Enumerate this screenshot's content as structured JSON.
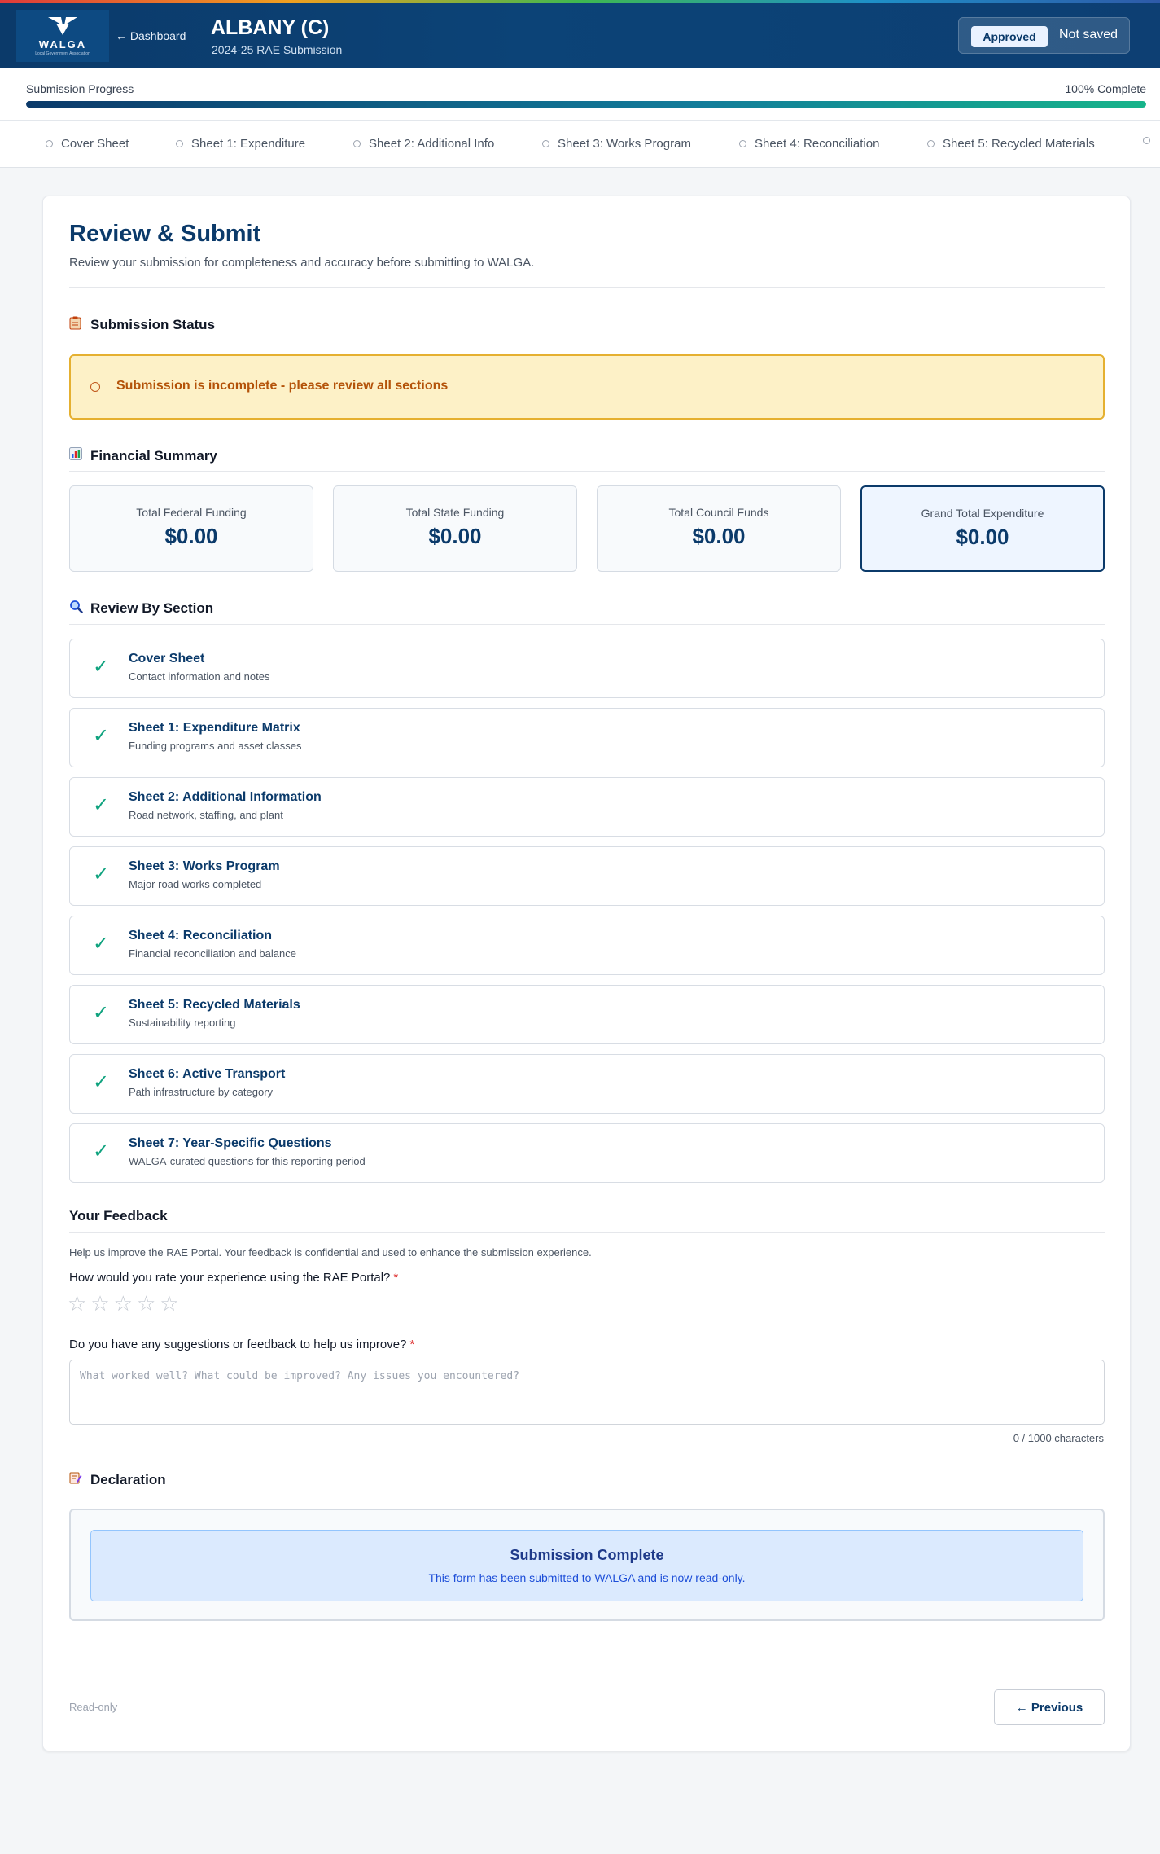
{
  "header": {
    "logo_text": "WALGA",
    "logo_sub": "Local Government Association",
    "back_label": "← Dashboard",
    "council_name": "ALBANY (C)",
    "subtitle": "2024-25 RAE Submission",
    "status_badge": "Approved",
    "save_status": "Not saved"
  },
  "progress": {
    "label": "Submission Progress",
    "percent_label": "100% Complete",
    "percent": 100
  },
  "tabs": [
    {
      "label": "Cover Sheet"
    },
    {
      "label": "Sheet 1: Expenditure"
    },
    {
      "label": "Sheet 2: Additional Info"
    },
    {
      "label": "Sheet 3: Works Program"
    },
    {
      "label": "Sheet 4: Reconciliation"
    },
    {
      "label": "Sheet 5: Recycled Materials"
    }
  ],
  "page": {
    "title": "Review & Submit",
    "description": "Review your submission for completeness and accuracy before submitting to WALGA."
  },
  "status_section": {
    "title": "Submission Status",
    "icon": "clipboard-icon",
    "alert_text": "Submission is incomplete - please review all sections"
  },
  "financial": {
    "title": "Financial Summary",
    "icon": "bar-chart-icon",
    "cards": [
      {
        "label": "Total Federal Funding",
        "value": "$0.00"
      },
      {
        "label": "Total State Funding",
        "value": "$0.00"
      },
      {
        "label": "Total Council Funds",
        "value": "$0.00"
      },
      {
        "label": "Grand Total Expenditure",
        "value": "$0.00"
      }
    ]
  },
  "review": {
    "title": "Review By Section",
    "icon": "magnifier-icon",
    "items": [
      {
        "title": "Cover Sheet",
        "subtitle": "Contact information and notes"
      },
      {
        "title": "Sheet 1: Expenditure Matrix",
        "subtitle": "Funding programs and asset classes"
      },
      {
        "title": "Sheet 2: Additional Information",
        "subtitle": "Road network, staffing, and plant"
      },
      {
        "title": "Sheet 3: Works Program",
        "subtitle": "Major road works completed"
      },
      {
        "title": "Sheet 4: Reconciliation",
        "subtitle": "Financial reconciliation and balance"
      },
      {
        "title": "Sheet 5: Recycled Materials",
        "subtitle": "Sustainability reporting"
      },
      {
        "title": "Sheet 6: Active Transport",
        "subtitle": "Path infrastructure by category"
      },
      {
        "title": "Sheet 7: Year-Specific Questions",
        "subtitle": "WALGA-curated questions for this reporting period"
      }
    ]
  },
  "feedback": {
    "title": "Your Feedback",
    "description": "Help us improve the RAE Portal. Your feedback is confidential and used to enhance the submission experience.",
    "rating_question": "How would you rate your experience using the RAE Portal?",
    "suggestion_question": "Do you have any suggestions or feedback to help us improve?",
    "required_mark": "*",
    "placeholder": "What worked well? What could be improved? Any issues you encountered?",
    "value": "",
    "char_count": "0 / 1000 characters",
    "rating": 0,
    "max_rating": 5
  },
  "declaration": {
    "title": "Declaration",
    "icon": "pen-icon",
    "complete_title": "Submission Complete",
    "complete_desc": "This form has been submitted to WALGA and is now read-only."
  },
  "footer": {
    "readonly_label": "Read-only",
    "previous_label": "← Previous"
  },
  "colors": {
    "brand": "#0b3a6a",
    "success": "#10a37f",
    "warning_bg": "#fdf1c7",
    "warning_border": "#e5b030"
  }
}
